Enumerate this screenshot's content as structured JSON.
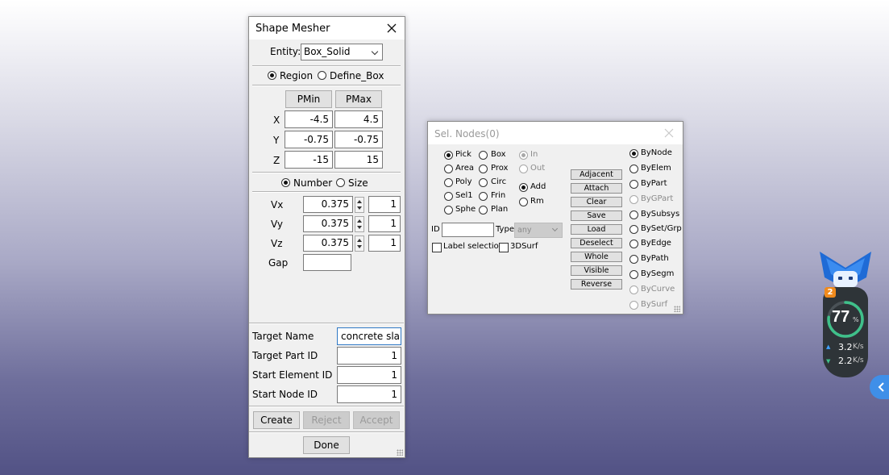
{
  "shape_mesher": {
    "title": "Shape Mesher",
    "entity_label": "Entity:",
    "entity_value": "Box_Solid",
    "region_label": "Region",
    "define_box_label": "Define_Box",
    "pmin_label": "PMin",
    "pmax_label": "PMax",
    "rows": [
      {
        "axis": "X",
        "pmin": "-4.5",
        "pmax": "4.5"
      },
      {
        "axis": "Y",
        "pmin": "-0.75",
        "pmax": "-0.75"
      },
      {
        "axis": "Z",
        "pmin": "-15",
        "pmax": "15"
      }
    ],
    "number_label": "Number",
    "size_label": "Size",
    "v_rows": [
      {
        "label": "Vx",
        "size": "0.375",
        "count": "1"
      },
      {
        "label": "Vy",
        "size": "0.375",
        "count": "1"
      },
      {
        "label": "Vz",
        "size": "0.375",
        "count": "1"
      }
    ],
    "gap_label": "Gap",
    "gap_value": "",
    "target_name_label": "Target Name",
    "target_name_value": "concrete slab",
    "target_part_id_label": "Target Part ID",
    "target_part_id_value": "1",
    "start_element_id_label": "Start Element ID",
    "start_element_id_value": "1",
    "start_node_id_label": "Start Node ID",
    "start_node_id_value": "1",
    "create_label": "Create",
    "reject_label": "Reject",
    "accept_label": "Accept",
    "done_label": "Done"
  },
  "sel_nodes": {
    "title": "Sel. Nodes(0)",
    "pick": "Pick",
    "box": "Box",
    "area": "Area",
    "prox": "Prox",
    "poly": "Poly",
    "circ": "Circ",
    "sel1": "Sel1",
    "frin": "Frin",
    "sphe": "Sphe",
    "plan": "Plan",
    "in": "In",
    "out": "Out",
    "add": "Add",
    "rm": "Rm",
    "id_label": "ID",
    "id_value": "",
    "type_label": "Type",
    "type_value": "any",
    "label_selection": "Label selection",
    "surf3d": "3DSurf",
    "buttons": [
      "Adjacent",
      "Attach",
      "Clear",
      "Save",
      "Load",
      "Deselect",
      "Whole",
      "Visible",
      "Reverse"
    ],
    "by_options": [
      "ByNode",
      "ByElem",
      "ByPart",
      "ByGPart",
      "BySubsys",
      "BySet/Grp",
      "ByEdge",
      "ByPath",
      "BySegm",
      "ByCurve",
      "BySurf"
    ]
  },
  "widget": {
    "badge": "2",
    "percent": "77",
    "percent_sign": "%",
    "up_value": "3.2",
    "up_unit": "K/s",
    "down_value": "2.2",
    "down_unit": "K/s"
  }
}
